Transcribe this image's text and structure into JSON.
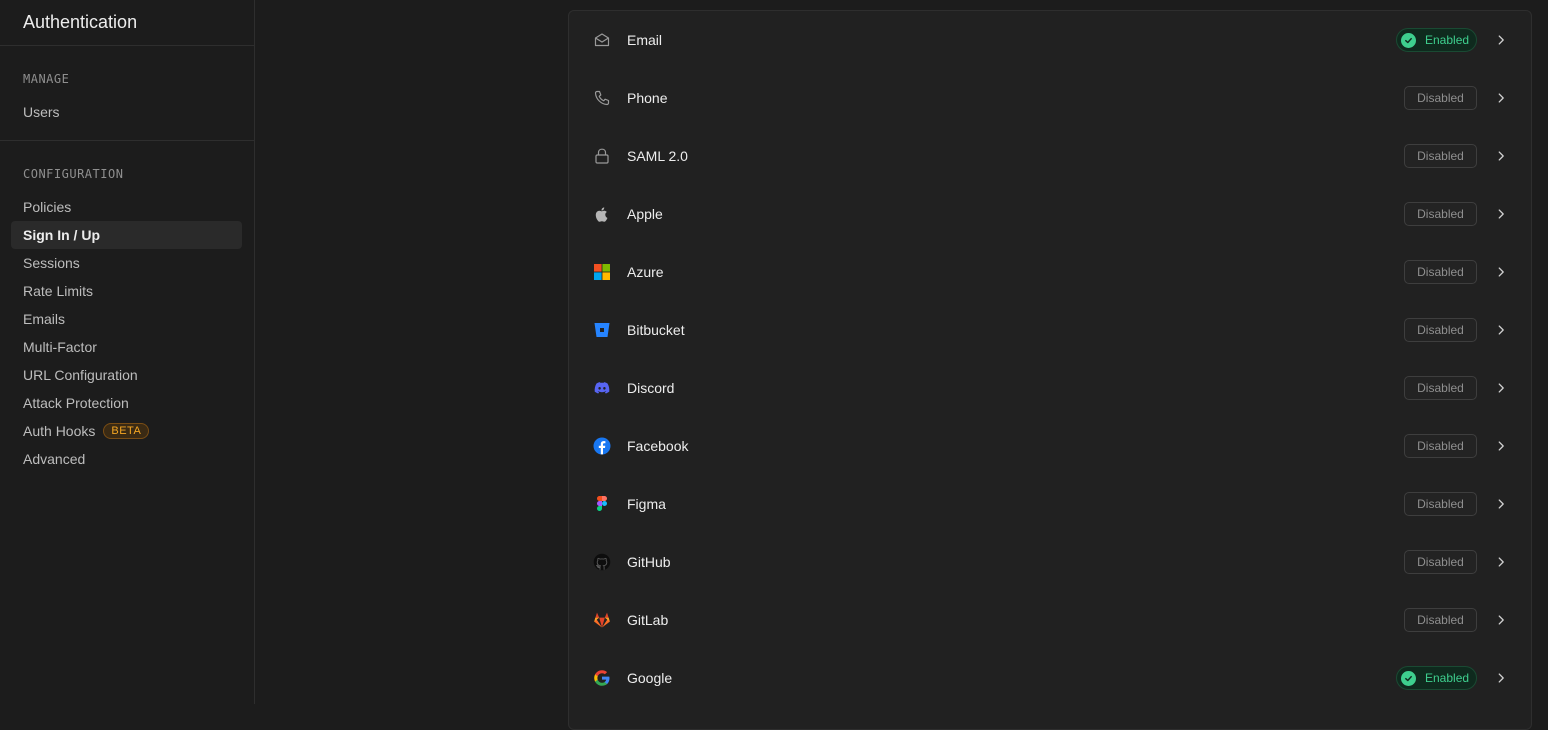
{
  "sidebar": {
    "title": "Authentication",
    "manage": {
      "heading": "MANAGE",
      "items": [
        {
          "label": "Users"
        }
      ]
    },
    "configuration": {
      "heading": "CONFIGURATION",
      "items": [
        {
          "label": "Policies"
        },
        {
          "label": "Sign In / Up",
          "active": true
        },
        {
          "label": "Sessions"
        },
        {
          "label": "Rate Limits"
        },
        {
          "label": "Emails"
        },
        {
          "label": "Multi-Factor"
        },
        {
          "label": "URL Configuration"
        },
        {
          "label": "Attack Protection"
        },
        {
          "label": "Auth Hooks",
          "badge": "BETA"
        },
        {
          "label": "Advanced"
        }
      ]
    }
  },
  "providers": [
    {
      "name": "Email",
      "icon": "envelope-icon",
      "status": "Enabled"
    },
    {
      "name": "Phone",
      "icon": "phone-icon",
      "status": "Disabled"
    },
    {
      "name": "SAML 2.0",
      "icon": "lock-icon",
      "status": "Disabled"
    },
    {
      "name": "Apple",
      "icon": "apple-icon",
      "status": "Disabled"
    },
    {
      "name": "Azure",
      "icon": "azure-icon",
      "status": "Disabled"
    },
    {
      "name": "Bitbucket",
      "icon": "bitbucket-icon",
      "status": "Disabled"
    },
    {
      "name": "Discord",
      "icon": "discord-icon",
      "status": "Disabled"
    },
    {
      "name": "Facebook",
      "icon": "facebook-icon",
      "status": "Disabled"
    },
    {
      "name": "Figma",
      "icon": "figma-icon",
      "status": "Disabled"
    },
    {
      "name": "GitHub",
      "icon": "github-icon",
      "status": "Disabled"
    },
    {
      "name": "GitLab",
      "icon": "gitlab-icon",
      "status": "Disabled"
    },
    {
      "name": "Google",
      "icon": "google-icon",
      "status": "Enabled"
    }
  ],
  "colors": {
    "accent_green": "#3ecf8e",
    "beta_orange": "#f5a623",
    "background": "#1c1c1c",
    "panel": "#212121"
  }
}
